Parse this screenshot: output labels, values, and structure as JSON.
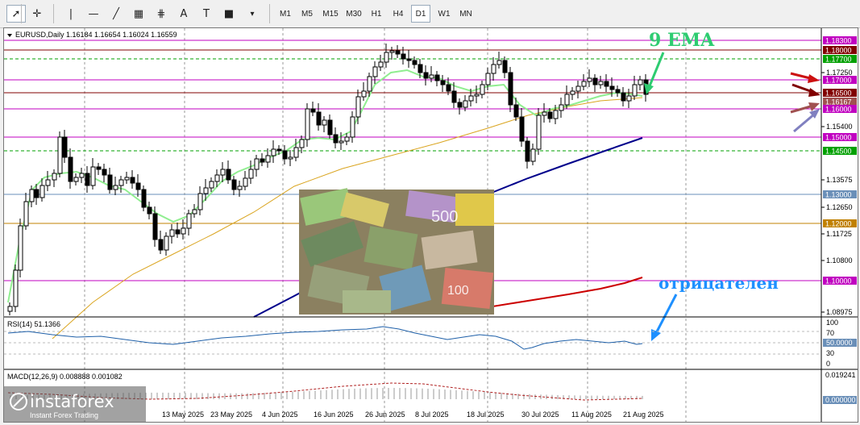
{
  "toolbar": {
    "tools": [
      {
        "name": "cursor-tool",
        "glyph": "➚"
      },
      {
        "name": "crosshair-tool",
        "glyph": "✛"
      },
      {
        "name": "vertical-line-tool",
        "glyph": "|"
      },
      {
        "name": "horizontal-line-tool",
        "glyph": "—"
      },
      {
        "name": "trendline-tool",
        "glyph": "╱"
      },
      {
        "name": "channel-tool",
        "glyph": "▦"
      },
      {
        "name": "fibonacci-tool",
        "glyph": "⋕"
      },
      {
        "name": "text-tool",
        "glyph": "A"
      },
      {
        "name": "text-label-tool",
        "glyph": "T"
      },
      {
        "name": "shapes-tool",
        "glyph": "■"
      }
    ],
    "timeframes": [
      "M1",
      "M5",
      "M15",
      "M30",
      "H1",
      "H4",
      "D1",
      "W1",
      "MN"
    ],
    "active_timeframe": "D1"
  },
  "chart": {
    "header": "EURUSD,Daily  1.16184 1.16654 1.16024 1.16559",
    "annotation_ema": "9 EMA",
    "annotation_negative": "отрицателен",
    "rsi_header": "RSI(14) 51.1366",
    "macd_header": "MACD(12,26,9) 0.008888 0.001082",
    "watermark_brand": "instaforex",
    "watermark_tagline": "Instant Forex Trading",
    "colors": {
      "ema9": "#90ee90",
      "ema50": "#daa520",
      "ema100": "#00008b",
      "ema200": "#cc0000",
      "annot_green": "#2ecc71",
      "annot_blue": "#1e90ff",
      "magenta": "#c000c0",
      "green_level": "#00a000"
    }
  },
  "price_axis": {
    "ticks": [
      "1.17250",
      "1.15400",
      "1.13575",
      "1.12650",
      "1.11725",
      "1.10800",
      "1.08975"
    ],
    "levels": [
      {
        "label": "1.18300",
        "color": "#c000c0",
        "line": "solid"
      },
      {
        "label": "1.18000",
        "color": "#800000",
        "line": "solid"
      },
      {
        "label": "1.17700",
        "color": "#00a000",
        "line": "dash"
      },
      {
        "label": "1.17000",
        "color": "#c000c0",
        "line": "solid"
      },
      {
        "label": "1.16500",
        "color": "#800000",
        "line": "solid"
      },
      {
        "label": "1.16167",
        "color": "#a05050",
        "line": "none"
      },
      {
        "label": "1.16000",
        "color": "#c000c0",
        "line": "solid"
      },
      {
        "label": "1.15000",
        "color": "#c000c0",
        "line": "solid"
      },
      {
        "label": "1.14500",
        "color": "#00a000",
        "line": "dash"
      },
      {
        "label": "1.13000",
        "color": "#6a8fb8",
        "line": "solid"
      },
      {
        "label": "1.12000",
        "color": "#c08000",
        "line": "solid"
      },
      {
        "label": "1.10000",
        "color": "#c000c0",
        "line": "solid"
      }
    ]
  },
  "rsi_axis": {
    "ticks": [
      "100",
      "70",
      "50.0000",
      "30",
      "0"
    ]
  },
  "macd_axis": {
    "ticks": [
      "0.019241",
      "0.000000"
    ]
  },
  "date_axis": {
    "labels": [
      "13 May 2025",
      "23 May 2025",
      "4 Jun 2025",
      "16 Jun 2025",
      "26 Jun 2025",
      "8 Jul 2025",
      "18 Jul 2025",
      "30 Jul 2025",
      "11 Aug 2025",
      "21 Aug 2025"
    ]
  }
}
